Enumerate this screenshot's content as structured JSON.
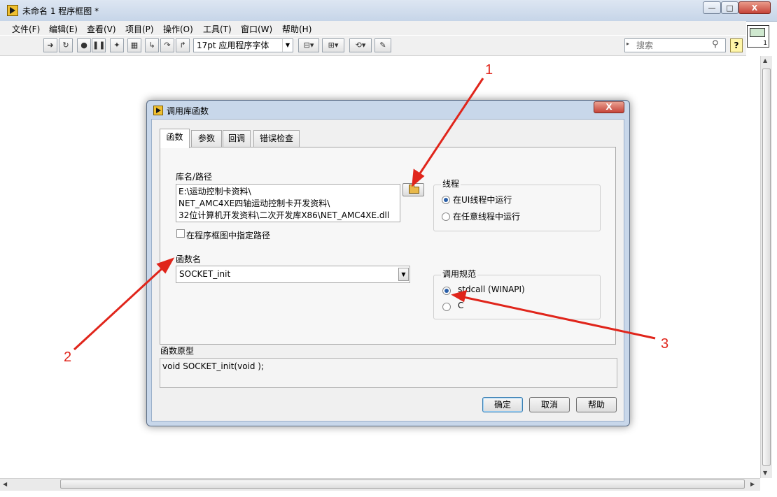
{
  "window": {
    "title": "未命名 1 程序框图 *",
    "controls": {
      "minimize": "—",
      "maximize": "□",
      "close": "X"
    }
  },
  "menu": [
    "文件(F)",
    "编辑(E)",
    "查看(V)",
    "项目(P)",
    "操作(O)",
    "工具(T)",
    "窗口(W)",
    "帮助(H)"
  ],
  "toolbar": {
    "font": "17pt 应用程序字体",
    "search_placeholder": "搜索",
    "help": "?",
    "vi_number": "1"
  },
  "dialog": {
    "title": "调用库函数",
    "close": "X",
    "tabs": [
      "函数",
      "参数",
      "回调",
      "错误检查"
    ],
    "library_label": "库名/路径",
    "library_path": [
      "E:\\运动控制卡资料\\",
      "NET_AMC4XE四轴运动控制卡开发资料\\",
      "32位计算机开发资料\\二次开发库X86\\NET_AMC4XE.dll"
    ],
    "specify_path_checkbox": "在程序框图中指定路径",
    "function_name_label": "函数名",
    "function_name": "SOCKET_init",
    "thread_group": {
      "title": "线程",
      "options": [
        "在UI线程中运行",
        "在任意线程中运行"
      ],
      "selected": 0
    },
    "calling_convention_group": {
      "title": "调用规范",
      "options": [
        "stdcall (WINAPI)",
        "C"
      ],
      "selected": 0
    },
    "prototype_label": "函数原型",
    "prototype": "void  SOCKET_init(void );",
    "buttons": {
      "ok": "确定",
      "cancel": "取消",
      "help": "帮助"
    }
  },
  "annotations": [
    "1",
    "2",
    "3"
  ],
  "colors": {
    "annotation": "#e0251b",
    "title_bar": "#c6d5e8",
    "radio_selected": "#2a5fa8"
  }
}
